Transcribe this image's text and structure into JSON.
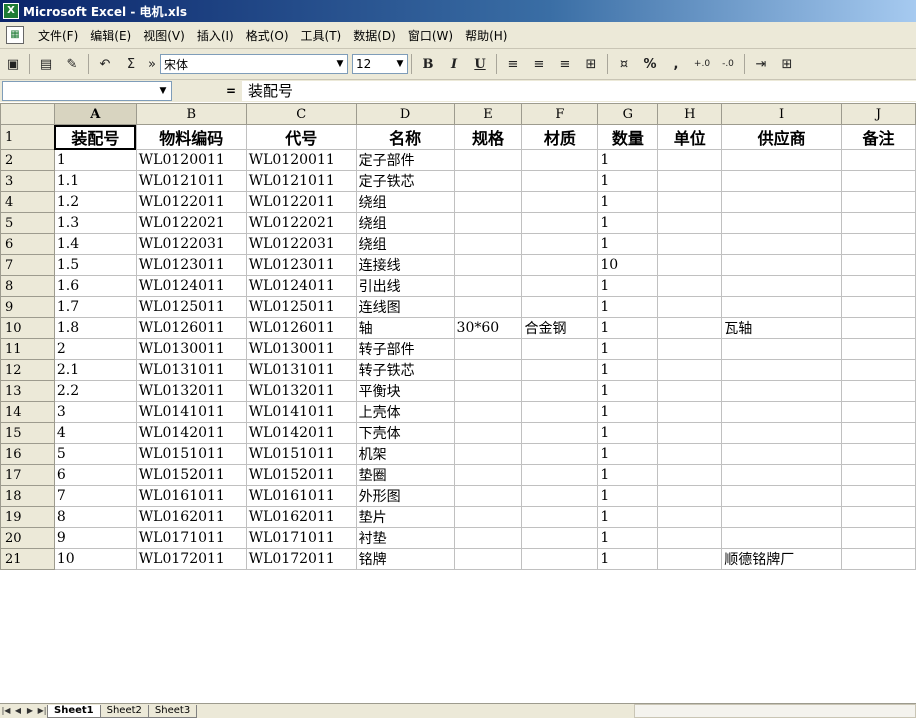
{
  "window": {
    "title": "Microsoft Excel - 电机.xls",
    "icon": "excel-icon"
  },
  "menu": [
    "文件(F)",
    "编辑(E)",
    "视图(V)",
    "插入(I)",
    "格式(O)",
    "工具(T)",
    "数据(D)",
    "窗口(W)",
    "帮助(H)"
  ],
  "toolbar": {
    "font_name": "宋体",
    "font_size": "12",
    "bold": "B",
    "italic": "I",
    "underline": "U",
    "percent": "%",
    "comma": ","
  },
  "formula_bar": {
    "name_box": "",
    "equals": "=",
    "content": "装配号"
  },
  "columns": [
    "A",
    "B",
    "C",
    "D",
    "E",
    "F",
    "G",
    "H",
    "I",
    "J"
  ],
  "rows": [
    {
      "n": "1",
      "cells": [
        "装配号",
        "物料编码",
        "代号",
        "名称",
        "规格",
        "材质",
        "数量",
        "单位",
        "供应商",
        "备注"
      ]
    },
    {
      "n": "2",
      "cells": [
        "1",
        "WL0120011",
        "WL0120011",
        "定子部件",
        "",
        "",
        "1",
        "",
        "",
        ""
      ]
    },
    {
      "n": "3",
      "cells": [
        "1.1",
        "WL0121011",
        "WL0121011",
        "定子铁芯",
        "",
        "",
        "1",
        "",
        "",
        ""
      ]
    },
    {
      "n": "4",
      "cells": [
        "1.2",
        "WL0122011",
        "WL0122011",
        "绕组",
        "",
        "",
        "1",
        "",
        "",
        ""
      ]
    },
    {
      "n": "5",
      "cells": [
        "1.3",
        "WL0122021",
        "WL0122021",
        "绕组",
        "",
        "",
        "1",
        "",
        "",
        ""
      ]
    },
    {
      "n": "6",
      "cells": [
        "1.4",
        "WL0122031",
        "WL0122031",
        "绕组",
        "",
        "",
        "1",
        "",
        "",
        ""
      ]
    },
    {
      "n": "7",
      "cells": [
        "1.5",
        "WL0123011",
        "WL0123011",
        "连接线",
        "",
        "",
        "10",
        "",
        "",
        ""
      ]
    },
    {
      "n": "8",
      "cells": [
        "1.6",
        "WL0124011",
        "WL0124011",
        "引出线",
        "",
        "",
        "1",
        "",
        "",
        ""
      ]
    },
    {
      "n": "9",
      "cells": [
        "1.7",
        "WL0125011",
        "WL0125011",
        "连线图",
        "",
        "",
        "1",
        "",
        "",
        ""
      ]
    },
    {
      "n": "10",
      "cells": [
        "1.8",
        "WL0126011",
        "WL0126011",
        "轴",
        "30*60",
        "合金钢",
        "1",
        "",
        "瓦轴",
        ""
      ]
    },
    {
      "n": "11",
      "cells": [
        "2",
        "WL0130011",
        "WL0130011",
        "转子部件",
        "",
        "",
        "1",
        "",
        "",
        ""
      ]
    },
    {
      "n": "12",
      "cells": [
        "2.1",
        "WL0131011",
        "WL0131011",
        "转子铁芯",
        "",
        "",
        "1",
        "",
        "",
        ""
      ]
    },
    {
      "n": "13",
      "cells": [
        "2.2",
        "WL0132011",
        "WL0132011",
        "平衡块",
        "",
        "",
        "1",
        "",
        "",
        ""
      ]
    },
    {
      "n": "14",
      "cells": [
        "3",
        "WL0141011",
        "WL0141011",
        "上壳体",
        "",
        "",
        "1",
        "",
        "",
        ""
      ]
    },
    {
      "n": "15",
      "cells": [
        "4",
        "WL0142011",
        "WL0142011",
        "下壳体",
        "",
        "",
        "1",
        "",
        "",
        ""
      ]
    },
    {
      "n": "16",
      "cells": [
        "5",
        "WL0151011",
        "WL0151011",
        "机架",
        "",
        "",
        "1",
        "",
        "",
        ""
      ]
    },
    {
      "n": "17",
      "cells": [
        "6",
        "WL0152011",
        "WL0152011",
        "垫圈",
        "",
        "",
        "1",
        "",
        "",
        ""
      ]
    },
    {
      "n": "18",
      "cells": [
        "7",
        "WL0161011",
        "WL0161011",
        "外形图",
        "",
        "",
        "1",
        "",
        "",
        ""
      ]
    },
    {
      "n": "19",
      "cells": [
        "8",
        "WL0162011",
        "WL0162011",
        "垫片",
        "",
        "",
        "1",
        "",
        "",
        ""
      ]
    },
    {
      "n": "20",
      "cells": [
        "9",
        "WL0171011",
        "WL0171011",
        "衬垫",
        "",
        "",
        "1",
        "",
        "",
        ""
      ]
    },
    {
      "n": "21",
      "cells": [
        "10",
        "WL0172011",
        "WL0172011",
        "铭牌",
        "",
        "",
        "1",
        "",
        "顺德铭牌厂",
        ""
      ]
    }
  ],
  "sheets": [
    "Sheet1",
    "Sheet2",
    "Sheet3"
  ],
  "active_sheet": "Sheet1"
}
